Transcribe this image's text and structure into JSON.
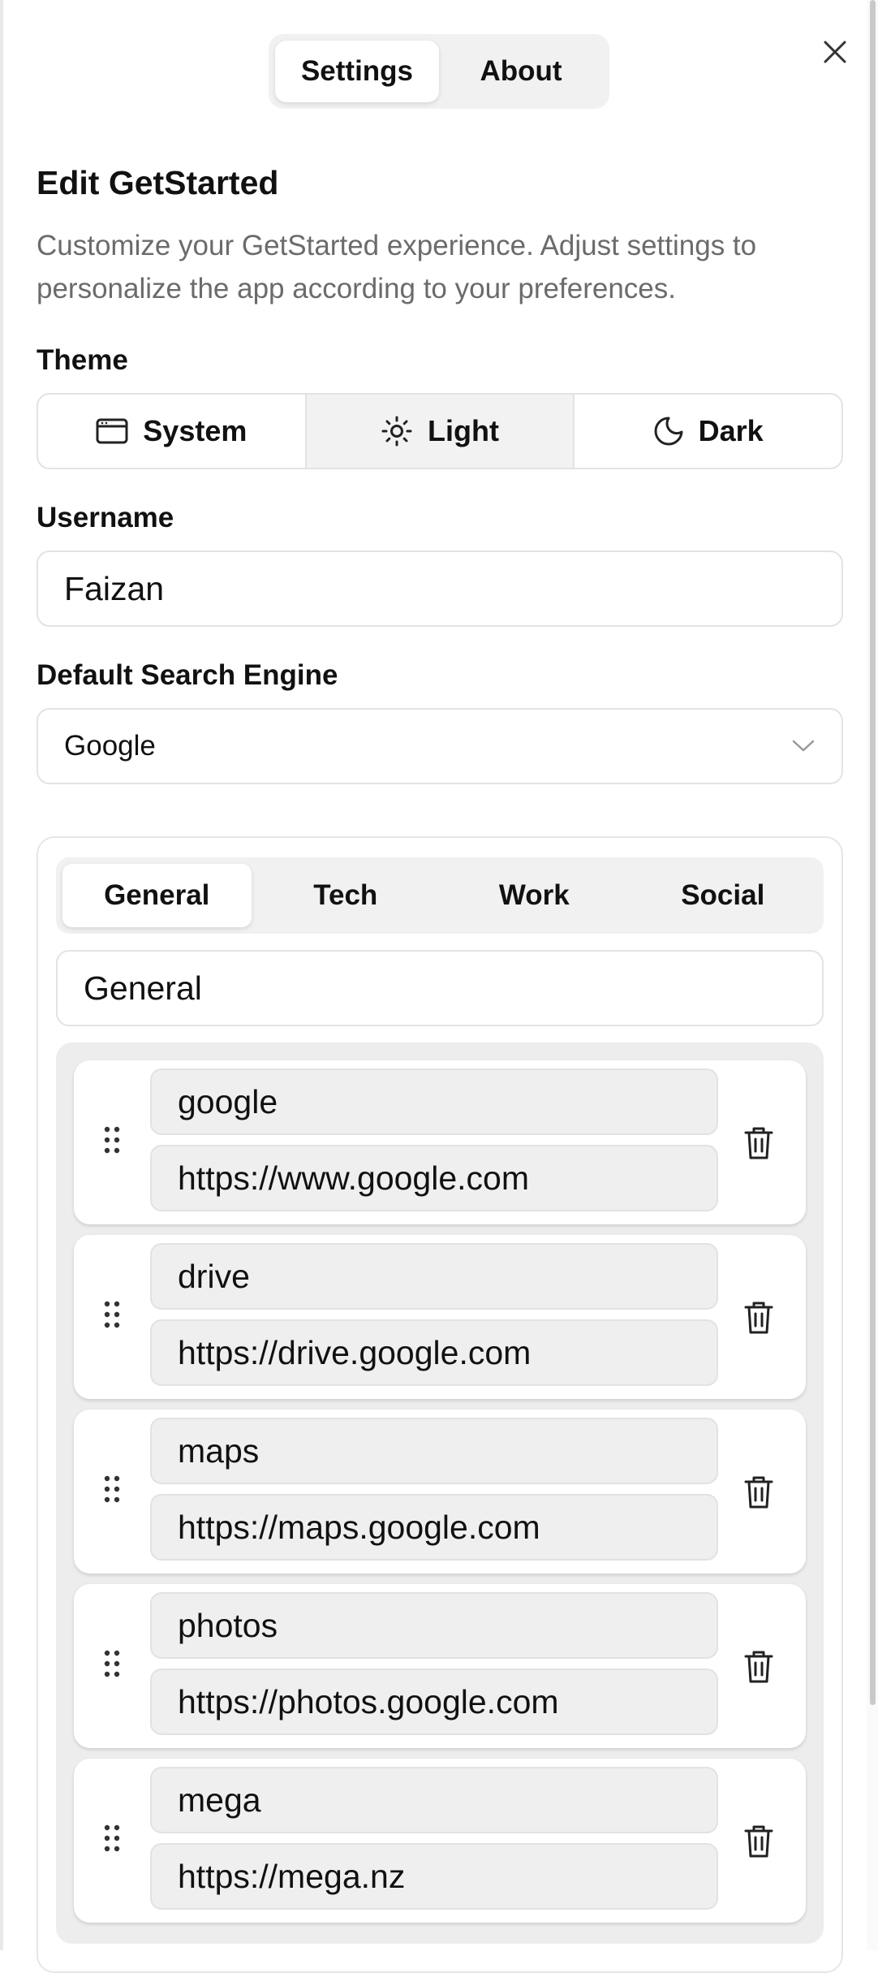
{
  "top_tabs": [
    {
      "label": "Settings",
      "active": true
    },
    {
      "label": "About",
      "active": false
    }
  ],
  "title": "Edit GetStarted",
  "description": "Customize your GetStarted experience. Adjust settings to personalize the app according to your preferences.",
  "theme": {
    "label": "Theme",
    "options": [
      {
        "label": "System",
        "icon": "monitor-icon"
      },
      {
        "label": "Light",
        "icon": "sun-icon"
      },
      {
        "label": "Dark",
        "icon": "moon-icon"
      }
    ],
    "selected": "Light"
  },
  "username": {
    "label": "Username",
    "value": "Faizan"
  },
  "search_engine": {
    "label": "Default Search Engine",
    "value": "Google"
  },
  "categories": {
    "tabs": [
      {
        "label": "General",
        "active": true
      },
      {
        "label": "Tech",
        "active": false
      },
      {
        "label": "Work",
        "active": false
      },
      {
        "label": "Social",
        "active": false
      }
    ],
    "current_name": "General",
    "links": [
      {
        "name": "google",
        "url": "https://www.google.com"
      },
      {
        "name": "drive",
        "url": "https://drive.google.com"
      },
      {
        "name": "maps",
        "url": "https://maps.google.com"
      },
      {
        "name": "photos",
        "url": "https://photos.google.com"
      },
      {
        "name": "mega",
        "url": "https://mega.nz"
      }
    ]
  }
}
